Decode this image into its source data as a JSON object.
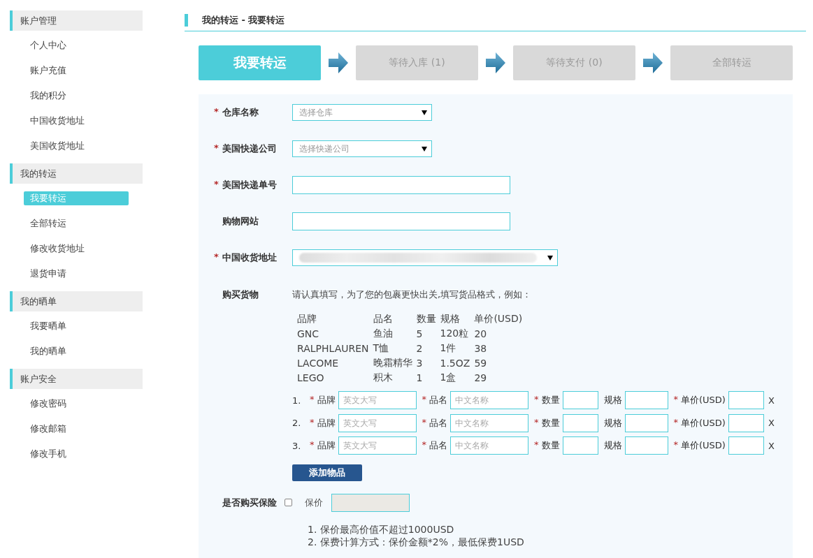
{
  "sidebar": {
    "groups": [
      {
        "title": "账户管理",
        "items": [
          {
            "label": "个人中心",
            "selected": false
          },
          {
            "label": "账户充值",
            "selected": false
          },
          {
            "label": "我的积分",
            "selected": false
          },
          {
            "label": "中国收货地址",
            "selected": false
          },
          {
            "label": "美国收货地址",
            "selected": false
          }
        ]
      },
      {
        "title": "我的转运",
        "items": [
          {
            "label": "我要转运",
            "selected": true
          },
          {
            "label": "全部转运",
            "selected": false
          },
          {
            "label": "修改收货地址",
            "selected": false
          },
          {
            "label": "退货申请",
            "selected": false
          }
        ]
      },
      {
        "title": "我的晒单",
        "items": [
          {
            "label": "我要晒单",
            "selected": false
          },
          {
            "label": "我的晒单",
            "selected": false
          }
        ]
      },
      {
        "title": "账户安全",
        "items": [
          {
            "label": "修改密码",
            "selected": false
          },
          {
            "label": "修改邮箱",
            "selected": false
          },
          {
            "label": "修改手机",
            "selected": false
          }
        ]
      }
    ]
  },
  "breadcrumb": "我的转运 - 我要转运",
  "steps": [
    {
      "label": "我要转运",
      "selected": true
    },
    {
      "label": "等待入库 (1)",
      "selected": false
    },
    {
      "label": "等待支付 (0)",
      "selected": false
    },
    {
      "label": "全部转运",
      "selected": false
    }
  ],
  "form": {
    "fields": [
      {
        "kind": "select",
        "mark": "*",
        "label": "仓库名称",
        "placeholder": "选择仓库"
      },
      {
        "kind": "select",
        "mark": "*",
        "label": "美国快递公司",
        "placeholder": "选择快递公司"
      },
      {
        "kind": "text",
        "mark": "*",
        "label": "美国快递单号"
      },
      {
        "kind": "text",
        "label": "购物网站"
      },
      {
        "kind": "blurred-select",
        "mark": "*",
        "label": "中国收货地址"
      }
    ],
    "goods": {
      "label": "购买货物",
      "hint": "请认真填写，为了您的包裹更快出关,填写货品格式，例如：",
      "example": {
        "columns": [
          "品牌",
          "品名",
          "数量",
          "规格",
          "单价(USD)"
        ],
        "rows": [
          [
            "GNC",
            "鱼油",
            "5",
            "120粒",
            "20"
          ],
          [
            "RALPHLAUREN",
            "T恤",
            "2",
            "1件",
            "38"
          ],
          [
            "LACOME",
            "晚霜精华",
            "3",
            "1.5OZ",
            "59"
          ],
          [
            "LEGO",
            "积木",
            "1",
            "1盒",
            "29"
          ]
        ]
      },
      "items": [
        {
          "number": "1.",
          "fields": [
            {
              "kind": "wide",
              "mark": "*",
              "label": "品牌",
              "placeholder": "英文大写"
            },
            {
              "kind": "wide",
              "mark": "*",
              "label": "品名",
              "placeholder": "中文名称"
            },
            {
              "kind": "narrow",
              "mark": "*",
              "label": "数量"
            },
            {
              "kind": "medium",
              "label": "规格"
            },
            {
              "kind": "narrow",
              "mark": "*",
              "label": "单价(USD)"
            }
          ],
          "remove": "X"
        },
        {
          "number": "2.",
          "fields": [
            {
              "kind": "wide",
              "mark": "*",
              "label": "品牌",
              "placeholder": "英文大写"
            },
            {
              "kind": "wide",
              "mark": "*",
              "label": "品名",
              "placeholder": "中文名称"
            },
            {
              "kind": "narrow",
              "mark": "*",
              "label": "数量"
            },
            {
              "kind": "medium",
              "label": "规格"
            },
            {
              "kind": "narrow",
              "mark": "*",
              "label": "单价(USD)"
            }
          ],
          "remove": "X"
        },
        {
          "number": "3.",
          "fields": [
            {
              "kind": "wide",
              "mark": "*",
              "label": "品牌",
              "placeholder": "英文大写"
            },
            {
              "kind": "wide",
              "mark": "*",
              "label": "品名",
              "placeholder": "中文名称"
            },
            {
              "kind": "narrow",
              "mark": "*",
              "label": "数量"
            },
            {
              "kind": "medium",
              "label": "规格"
            },
            {
              "kind": "narrow",
              "mark": "*",
              "label": "单价(USD)"
            }
          ],
          "remove": "X"
        }
      ],
      "add_button": "添加物品"
    },
    "insurance": {
      "label": "是否购买保险",
      "checked": false,
      "value_label": "保价",
      "disabled": true,
      "notes": [
        "1. 保价最高价值不超过1000USD",
        "2. 保费计算方式：保价金额*2%，最低保费1USD"
      ]
    }
  }
}
